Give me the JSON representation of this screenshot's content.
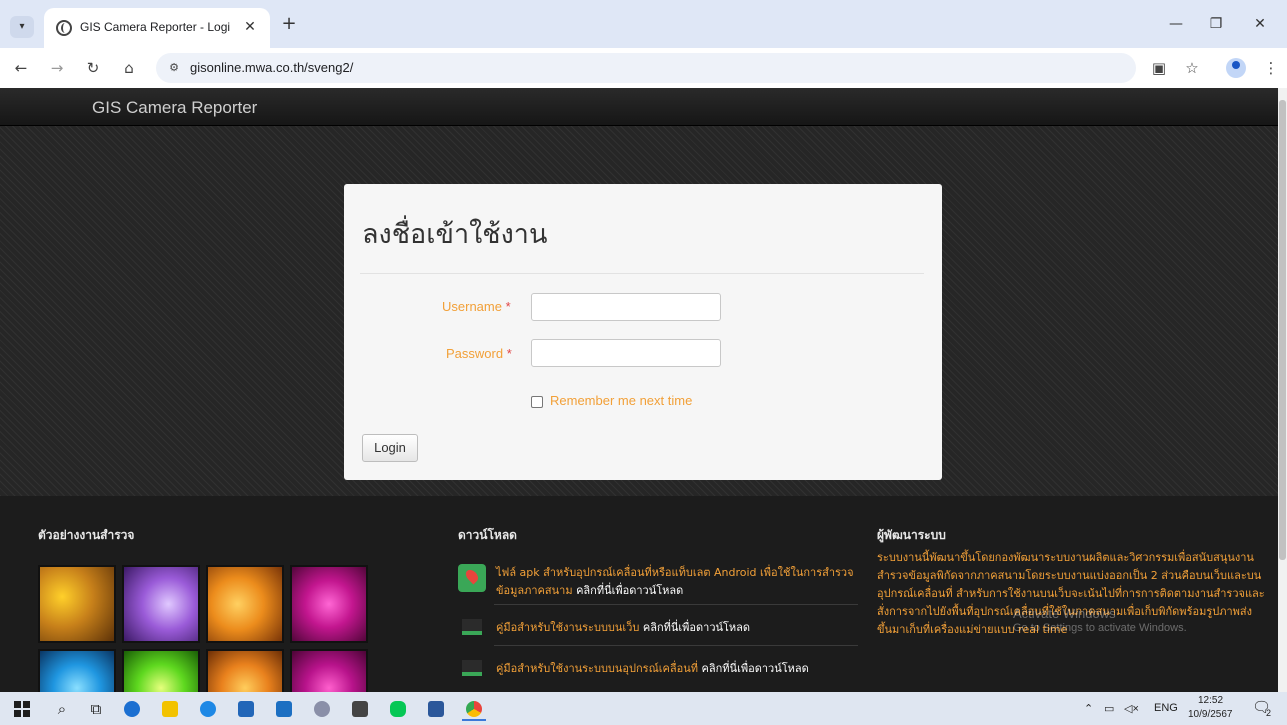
{
  "browser": {
    "tab_title": "GIS Camera Reporter - Login Si",
    "tab_close": "✕",
    "new_tab": "+",
    "url": "gisonline.mwa.co.th/sveng2/",
    "icons": [
      "tab-menu-icon",
      "favicon-icon",
      "back-icon",
      "forward-icon",
      "reload-icon",
      "home-icon",
      "site-settings-icon",
      "translate-icon",
      "star-icon",
      "profile-icon",
      "menu-dots-icon"
    ]
  },
  "site": {
    "brand": "GIS Camera Reporter"
  },
  "login": {
    "title": "ลงชื่อเข้าใช้งาน",
    "username_label": "Username",
    "password_label": "Password",
    "required_mark": "*",
    "username_value": "",
    "password_value": "",
    "remember_label": "Remember me next time",
    "remember_checked": false,
    "button_label": "Login"
  },
  "footer": {
    "survey_heading": "ตัวอย่างงานสำรวจ",
    "download_heading": "ดาวน์โหลด",
    "developer_heading": "ผู้พัฒนาระบบ",
    "downloads": [
      {
        "text": "ไฟล์ apk สำหรับอุปกรณ์เคลื่อนที่หรือแท็บเลต Android เพื่อใช้ในการสำรวจข้อมูลภาคสนาม",
        "link": "คลิกที่นี่เพื่อดาวน์โหลด"
      },
      {
        "text": "คู่มือสำหรับใช้งานระบบบนเว็บ",
        "link": "คลิกที่นี่เพื่อดาวน์โหลด"
      },
      {
        "text": "คู่มือสำหรับใช้งานระบบบนอุปกรณ์เคลื่อนที่",
        "link": "คลิกที่นี่เพื่อดาวน์โหลด"
      }
    ],
    "developer_text": "ระบบงานนี้พัฒนาขึ้นโดยกองพัฒนาระบบงานผลิตและวิศวกรรมเพื่อสนับสนุนงานสำรวจข้อมูลพิกัดจากภาคสนามโดยระบบงานแบ่งออกเป็น 2 ส่วนคือบนเว็บและบนอุปกรณ์เคลื่อนที่ สำหรับการใช้งานบนเว็บจะเน้นไปที่การการติดตามงานสำรวจและสั่งการจากไปยังพื้นที่อุปกรณ์เคลื่อนที่ใช้ในภาคสนามเพื่อเก็บพิกัดพร้อมรูปภาพส่งขึ้นมาเก็บที่เครื่องแม่ข่ายแบบ real time",
    "watermark_title": "Activate Windows",
    "watermark_text": "Go to Settings to activate Windows."
  },
  "taskbar": {
    "language": "ENG",
    "time": "12:52",
    "date": "10/9/2567",
    "notification_count": "2",
    "app_colors": {
      "edge": "#1b6fd1",
      "explorer": "#f2c200",
      "store": "#2266b8",
      "mail": "#1c6fc2",
      "calculator": "#444444",
      "line": "#06c755",
      "word": "#2b579a",
      "chrome": "#e8453c"
    }
  },
  "colors": {
    "accent_orange": "#f2a038",
    "required_red": "#e04444",
    "page_bg": "#262626"
  }
}
